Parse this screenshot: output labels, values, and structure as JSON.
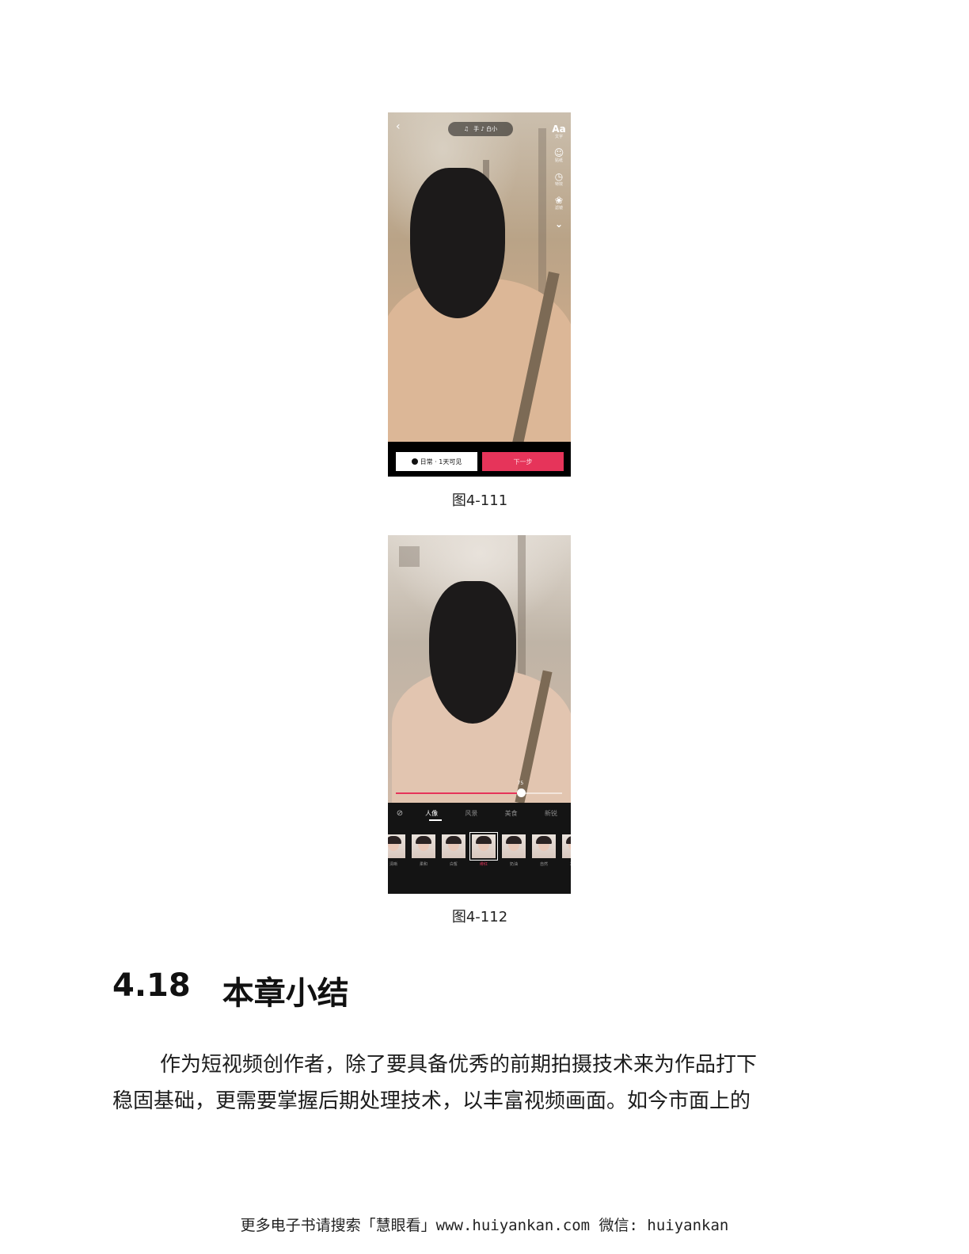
{
  "figure1": {
    "topbar": {
      "back_icon": "chevron-left-icon",
      "music_label": "♫",
      "pill_text": "手 ♪ 白小"
    },
    "tools": [
      {
        "icon": "text-icon",
        "glyph": "Aa",
        "caption": "文字"
      },
      {
        "icon": "sticker-icon",
        "glyph": "☺",
        "caption": "贴纸"
      },
      {
        "icon": "clock-icon",
        "glyph": "◷",
        "caption": "特效"
      },
      {
        "icon": "filter-icon",
        "glyph": "❀",
        "caption": "滤镜"
      },
      {
        "icon": "chevron-down-icon",
        "glyph": "⌄",
        "caption": ""
      }
    ],
    "visibility_button": "日常 · 1天可见",
    "next_button": "下一步"
  },
  "caption1": "图4-111",
  "figure2": {
    "slider_value": 0.75,
    "slider_label": "75",
    "tabs": [
      {
        "label": "人像",
        "active": true
      },
      {
        "label": "风景",
        "active": false
      },
      {
        "label": "美食",
        "active": false
      },
      {
        "label": "新锐",
        "active": false
      }
    ],
    "filters": [
      "清晰",
      "柔和",
      "白皙",
      "绯红",
      "奶油",
      "自然",
      "冷白"
    ],
    "selected_filter_index": 3
  },
  "caption2": "图4-112",
  "section": {
    "number": "4.18",
    "title": "本章小结"
  },
  "paragraph": {
    "line1": "作为短视频创作者，除了要具备优秀的前期拍摄技术来为作品打下",
    "line2": "稳固基础，更需要掌握后期处理技术，以丰富视频画面。如今市面上的"
  },
  "footer": "更多电子书请搜索「慧眼看」www.huiyankan.com  微信: huiyankan"
}
